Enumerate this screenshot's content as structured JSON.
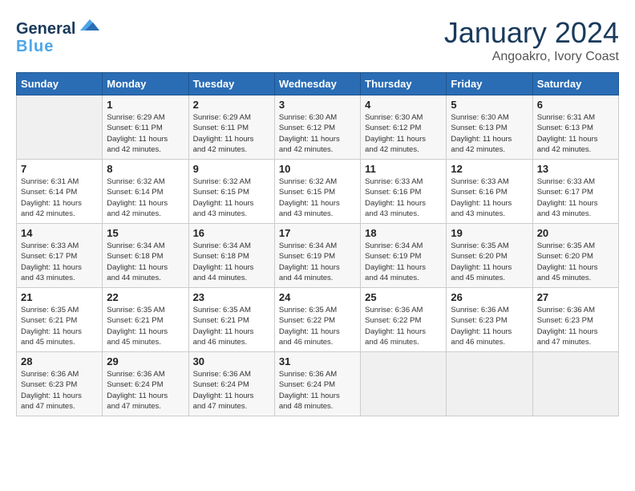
{
  "logo": {
    "line1": "General",
    "line2": "Blue"
  },
  "title": "January 2024",
  "subtitle": "Angoakro, Ivory Coast",
  "days_of_week": [
    "Sunday",
    "Monday",
    "Tuesday",
    "Wednesday",
    "Thursday",
    "Friday",
    "Saturday"
  ],
  "weeks": [
    [
      {
        "day": "",
        "info": ""
      },
      {
        "day": "1",
        "info": "Sunrise: 6:29 AM\nSunset: 6:11 PM\nDaylight: 11 hours\nand 42 minutes."
      },
      {
        "day": "2",
        "info": "Sunrise: 6:29 AM\nSunset: 6:11 PM\nDaylight: 11 hours\nand 42 minutes."
      },
      {
        "day": "3",
        "info": "Sunrise: 6:30 AM\nSunset: 6:12 PM\nDaylight: 11 hours\nand 42 minutes."
      },
      {
        "day": "4",
        "info": "Sunrise: 6:30 AM\nSunset: 6:12 PM\nDaylight: 11 hours\nand 42 minutes."
      },
      {
        "day": "5",
        "info": "Sunrise: 6:30 AM\nSunset: 6:13 PM\nDaylight: 11 hours\nand 42 minutes."
      },
      {
        "day": "6",
        "info": "Sunrise: 6:31 AM\nSunset: 6:13 PM\nDaylight: 11 hours\nand 42 minutes."
      }
    ],
    [
      {
        "day": "7",
        "info": "Sunrise: 6:31 AM\nSunset: 6:14 PM\nDaylight: 11 hours\nand 42 minutes."
      },
      {
        "day": "8",
        "info": "Sunrise: 6:32 AM\nSunset: 6:14 PM\nDaylight: 11 hours\nand 42 minutes."
      },
      {
        "day": "9",
        "info": "Sunrise: 6:32 AM\nSunset: 6:15 PM\nDaylight: 11 hours\nand 43 minutes."
      },
      {
        "day": "10",
        "info": "Sunrise: 6:32 AM\nSunset: 6:15 PM\nDaylight: 11 hours\nand 43 minutes."
      },
      {
        "day": "11",
        "info": "Sunrise: 6:33 AM\nSunset: 6:16 PM\nDaylight: 11 hours\nand 43 minutes."
      },
      {
        "day": "12",
        "info": "Sunrise: 6:33 AM\nSunset: 6:16 PM\nDaylight: 11 hours\nand 43 minutes."
      },
      {
        "day": "13",
        "info": "Sunrise: 6:33 AM\nSunset: 6:17 PM\nDaylight: 11 hours\nand 43 minutes."
      }
    ],
    [
      {
        "day": "14",
        "info": "Sunrise: 6:33 AM\nSunset: 6:17 PM\nDaylight: 11 hours\nand 43 minutes."
      },
      {
        "day": "15",
        "info": "Sunrise: 6:34 AM\nSunset: 6:18 PM\nDaylight: 11 hours\nand 44 minutes."
      },
      {
        "day": "16",
        "info": "Sunrise: 6:34 AM\nSunset: 6:18 PM\nDaylight: 11 hours\nand 44 minutes."
      },
      {
        "day": "17",
        "info": "Sunrise: 6:34 AM\nSunset: 6:19 PM\nDaylight: 11 hours\nand 44 minutes."
      },
      {
        "day": "18",
        "info": "Sunrise: 6:34 AM\nSunset: 6:19 PM\nDaylight: 11 hours\nand 44 minutes."
      },
      {
        "day": "19",
        "info": "Sunrise: 6:35 AM\nSunset: 6:20 PM\nDaylight: 11 hours\nand 45 minutes."
      },
      {
        "day": "20",
        "info": "Sunrise: 6:35 AM\nSunset: 6:20 PM\nDaylight: 11 hours\nand 45 minutes."
      }
    ],
    [
      {
        "day": "21",
        "info": "Sunrise: 6:35 AM\nSunset: 6:21 PM\nDaylight: 11 hours\nand 45 minutes."
      },
      {
        "day": "22",
        "info": "Sunrise: 6:35 AM\nSunset: 6:21 PM\nDaylight: 11 hours\nand 45 minutes."
      },
      {
        "day": "23",
        "info": "Sunrise: 6:35 AM\nSunset: 6:21 PM\nDaylight: 11 hours\nand 46 minutes."
      },
      {
        "day": "24",
        "info": "Sunrise: 6:35 AM\nSunset: 6:22 PM\nDaylight: 11 hours\nand 46 minutes."
      },
      {
        "day": "25",
        "info": "Sunrise: 6:36 AM\nSunset: 6:22 PM\nDaylight: 11 hours\nand 46 minutes."
      },
      {
        "day": "26",
        "info": "Sunrise: 6:36 AM\nSunset: 6:23 PM\nDaylight: 11 hours\nand 46 minutes."
      },
      {
        "day": "27",
        "info": "Sunrise: 6:36 AM\nSunset: 6:23 PM\nDaylight: 11 hours\nand 47 minutes."
      }
    ],
    [
      {
        "day": "28",
        "info": "Sunrise: 6:36 AM\nSunset: 6:23 PM\nDaylight: 11 hours\nand 47 minutes."
      },
      {
        "day": "29",
        "info": "Sunrise: 6:36 AM\nSunset: 6:24 PM\nDaylight: 11 hours\nand 47 minutes."
      },
      {
        "day": "30",
        "info": "Sunrise: 6:36 AM\nSunset: 6:24 PM\nDaylight: 11 hours\nand 47 minutes."
      },
      {
        "day": "31",
        "info": "Sunrise: 6:36 AM\nSunset: 6:24 PM\nDaylight: 11 hours\nand 48 minutes."
      },
      {
        "day": "",
        "info": ""
      },
      {
        "day": "",
        "info": ""
      },
      {
        "day": "",
        "info": ""
      }
    ]
  ]
}
